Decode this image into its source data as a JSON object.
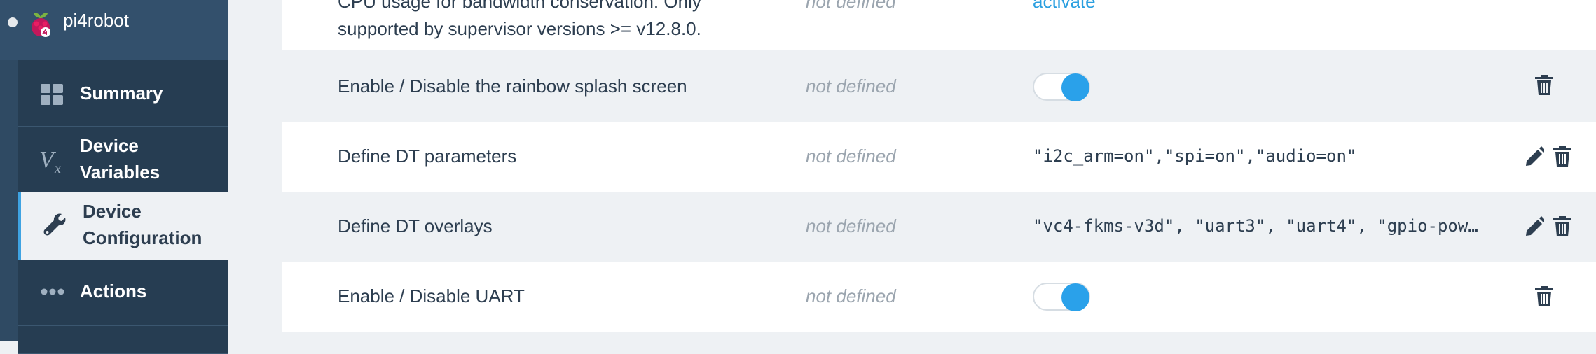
{
  "sidebar": {
    "device_name": "pi4robot",
    "device_logo_icon": "raspberry-pi-logo-icon",
    "items": [
      {
        "label": "Summary",
        "icon": "grid-icon"
      },
      {
        "label_line1": "Device",
        "label_line2": "Variables",
        "icon": "variables-icon"
      },
      {
        "label_line1": "Device",
        "label_line2": "Configuration",
        "icon": "wrench-icon",
        "active": true
      },
      {
        "label": "Actions",
        "icon": "dots-icon"
      }
    ]
  },
  "settings": {
    "rows": [
      {
        "name_line1": "CPU usage for bandwidth conservation. Only",
        "name_line2": "supported by supervisor versions >= v12.8.0.",
        "default": "not defined",
        "value": "activate"
      },
      {
        "name": "Enable / Disable the rainbow splash screen",
        "default": "not defined",
        "toggle_on": true
      },
      {
        "name": "Define DT parameters",
        "default": "not defined",
        "value": "\"i2c_arm=on\",\"spi=on\",\"audio=on\""
      },
      {
        "name": "Define DT overlays",
        "default": "not defined",
        "value": "\"vc4-fkms-v3d\", \"uart3\", \"uart4\", \"gpio-pow…"
      },
      {
        "name": "Enable / Disable UART",
        "default": "not defined",
        "toggle_on": true
      }
    ]
  },
  "colors": {
    "sidebar_bg": "#2f4a63",
    "nav_bg": "#263d52",
    "accent": "#2aa1ea",
    "link": "#2a9fe0",
    "text": "#2d3e50",
    "muted": "#9ba5af"
  }
}
